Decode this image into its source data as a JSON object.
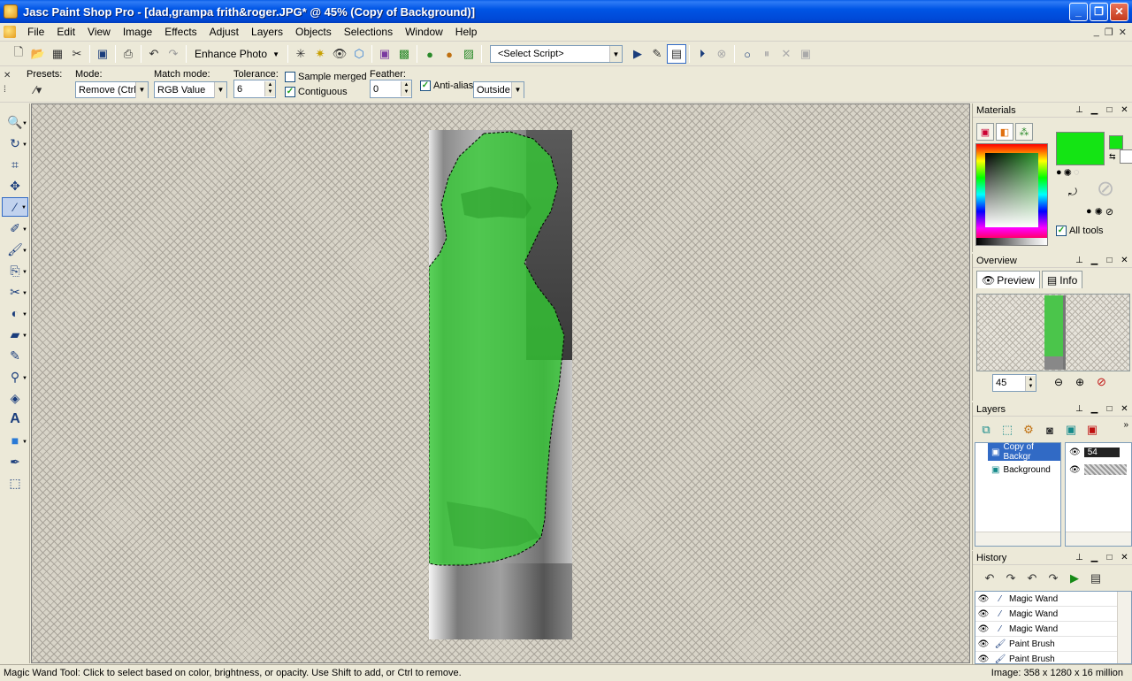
{
  "window": {
    "title": "Jasc Paint Shop Pro - [dad,grampa frith&roger.JPG* @  45% (Copy of Background)]"
  },
  "menu": [
    "File",
    "Edit",
    "View",
    "Image",
    "Effects",
    "Adjust",
    "Layers",
    "Objects",
    "Selections",
    "Window",
    "Help"
  ],
  "toolbar": {
    "enhance_photo_label": "Enhance Photo",
    "script_select_value": "<Select Script>"
  },
  "tool_options": {
    "presets_label": "Presets:",
    "mode_label": "Mode:",
    "mode_value": "Remove (Ctrl)",
    "match_mode_label": "Match mode:",
    "match_mode_value": "RGB Value",
    "tolerance_label": "Tolerance:",
    "tolerance_value": "6",
    "sample_merged_label": "Sample merged",
    "sample_merged_checked": false,
    "contiguous_label": "Contiguous",
    "contiguous_checked": true,
    "feather_label": "Feather:",
    "feather_value": "0",
    "anti_alias_label": "Anti-alias",
    "anti_alias_checked": true,
    "outside_value": "Outside"
  },
  "materials": {
    "title": "Materials",
    "foreground_color": "#14e414",
    "all_tools_label": "All tools",
    "all_tools_checked": true
  },
  "overview": {
    "title": "Overview",
    "tabs": [
      {
        "label": "Preview",
        "icon": "eye-icon"
      },
      {
        "label": "Info",
        "icon": "document-icon"
      }
    ],
    "zoom_value": "45"
  },
  "layers": {
    "title": "Layers",
    "items": [
      {
        "name": "Copy of Backgr",
        "opacity": "54",
        "selected": true
      },
      {
        "name": "Background",
        "opacity": "",
        "selected": false
      }
    ]
  },
  "history": {
    "title": "History",
    "items": [
      {
        "label": "Magic Wand",
        "icon": "magic-wand-icon"
      },
      {
        "label": "Magic Wand",
        "icon": "magic-wand-icon"
      },
      {
        "label": "Magic Wand",
        "icon": "magic-wand-icon"
      },
      {
        "label": "Paint Brush",
        "icon": "paint-brush-icon"
      },
      {
        "label": "Paint Brush",
        "icon": "paint-brush-icon"
      }
    ]
  },
  "status": {
    "message": "Magic Wand Tool: Click to select based on color, brightness, or opacity. Use Shift to add, or Ctrl to remove.",
    "image_info": "Image:  358 x 1280 x 16 million"
  }
}
